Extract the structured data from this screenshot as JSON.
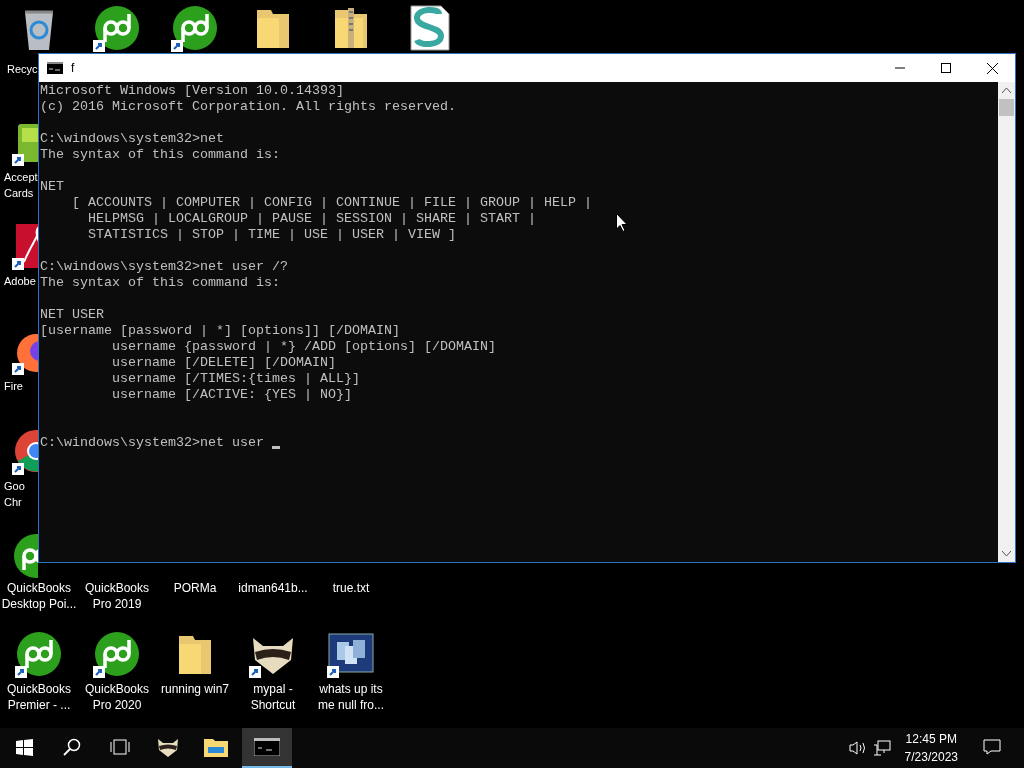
{
  "desktop": {
    "top_row": [
      {
        "kind": "recycle-bin",
        "shortcut": false
      },
      {
        "kind": "qb",
        "shortcut": true
      },
      {
        "kind": "qb",
        "shortcut": true
      },
      {
        "kind": "folder",
        "shortcut": false
      },
      {
        "kind": "zip-folder",
        "shortcut": false
      },
      {
        "kind": "script",
        "shortcut": false
      }
    ],
    "top_left_label": "Recyc",
    "left_column": [
      {
        "kind": "cards",
        "shortcut": true,
        "label": "Accept Cards"
      },
      {
        "kind": "adobe",
        "shortcut": true,
        "label": "Adobe"
      },
      {
        "kind": "firefox",
        "shortcut": true,
        "label": "Fire"
      },
      {
        "kind": "chrome",
        "shortcut": true,
        "label": "Goo Chr"
      },
      {
        "kind": "qb",
        "shortcut": false
      }
    ],
    "middle_row": [
      "QuickBooks Desktop Poi...",
      "QuickBooks Pro 2019",
      "PORMa",
      "idman641b...",
      "true.txt"
    ],
    "bottom_row": [
      {
        "kind": "qb",
        "shortcut": true,
        "label": "QuickBooks Premier - ..."
      },
      {
        "kind": "qb",
        "shortcut": true,
        "label": "QuickBooks Pro 2020"
      },
      {
        "kind": "folder",
        "shortcut": false,
        "label": "running win7"
      },
      {
        "kind": "raccoon",
        "shortcut": true,
        "label": "mypal - Shortcut"
      },
      {
        "kind": "app-window",
        "shortcut": true,
        "label": "whats up its me null fro..."
      }
    ]
  },
  "window": {
    "title": "f",
    "console": {
      "blocks": [
        [
          "Microsoft Windows [Version 10.0.14393]",
          "(c) 2016 Microsoft Corporation. All rights reserved."
        ],
        [
          "C:\\windows\\system32>net",
          "The syntax of this command is:"
        ],
        [
          "NET",
          "    [ ACCOUNTS | COMPUTER | CONFIG | CONTINUE | FILE | GROUP | HELP |",
          "      HELPMSG | LOCALGROUP | PAUSE | SESSION | SHARE | START |",
          "      STATISTICS | STOP | TIME | USE | USER | VIEW ]"
        ],
        [
          "C:\\windows\\system32>net user /?",
          "The syntax of this command is:"
        ],
        [
          "NET USER",
          "[username [password | *] [options]] [/DOMAIN]",
          "         username {password | *} /ADD [options] [/DOMAIN]",
          "         username [/DELETE] [/DOMAIN]",
          "         username [/TIMES:{times | ALL}]",
          "         username [/ACTIVE: {YES | NO}]"
        ]
      ],
      "prompt": "C:\\windows\\system32>net user ",
      "cursor_visible": true
    }
  },
  "taskbar": {
    "apps": [
      {
        "kind": "raccoon",
        "selected": false
      },
      {
        "kind": "explorer",
        "selected": false
      },
      {
        "kind": "console",
        "selected": true
      }
    ],
    "time": "12:45 PM",
    "date": "7/23/2023"
  }
}
